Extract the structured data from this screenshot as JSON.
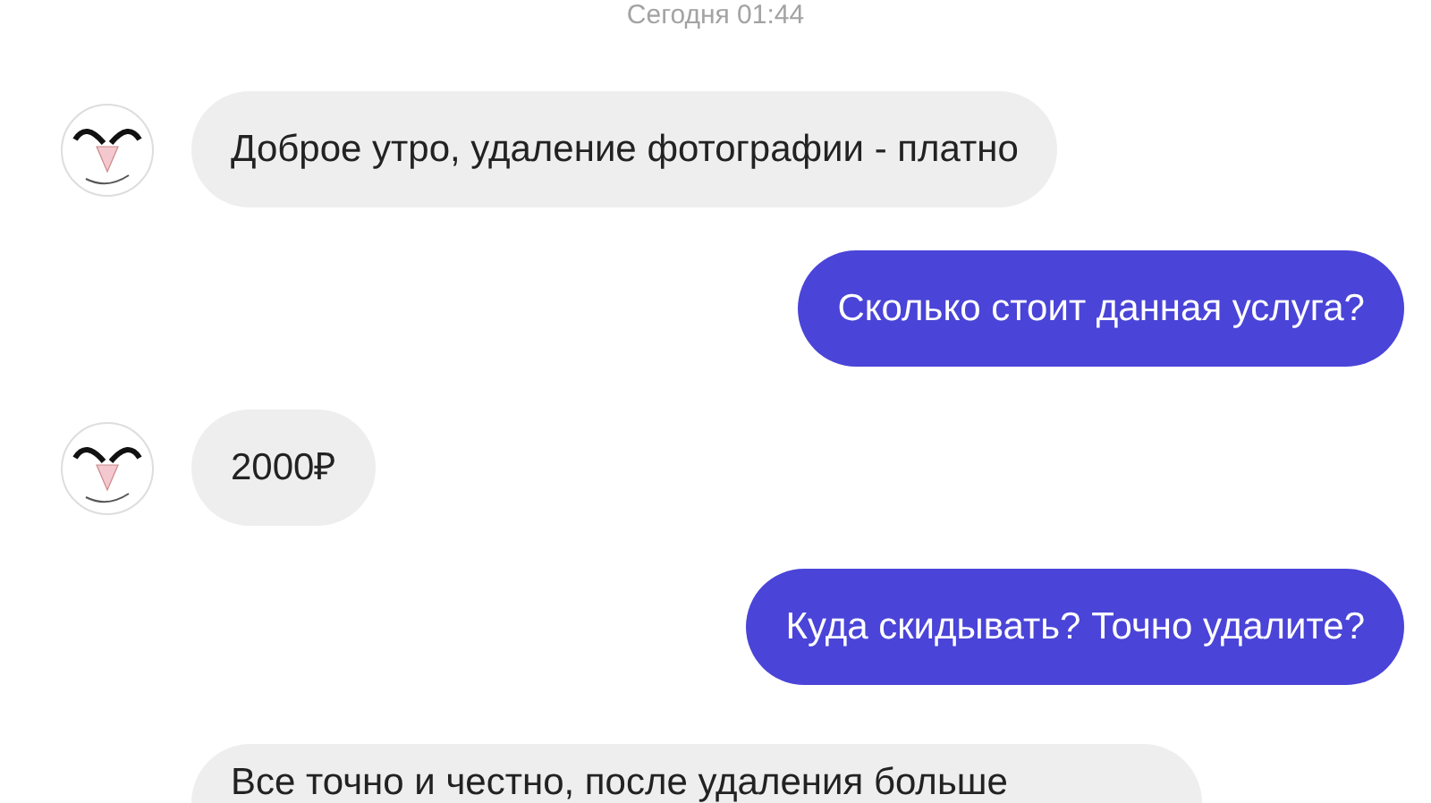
{
  "timestamp": "Сегодня 01:44",
  "messages": [
    {
      "kind": "received",
      "text": "Доброе утро, удаление фотографии - платно",
      "avatar": true
    },
    {
      "kind": "sent",
      "text": "Сколько стоит данная услуга?",
      "avatar": false
    },
    {
      "kind": "received",
      "text": "2000₽",
      "avatar": true
    },
    {
      "kind": "sent",
      "text": "Куда скидывать? Точно удалите?",
      "avatar": false
    },
    {
      "kind": "received",
      "text": "Все точно и честно, после удаления больше",
      "avatar": false
    }
  ]
}
